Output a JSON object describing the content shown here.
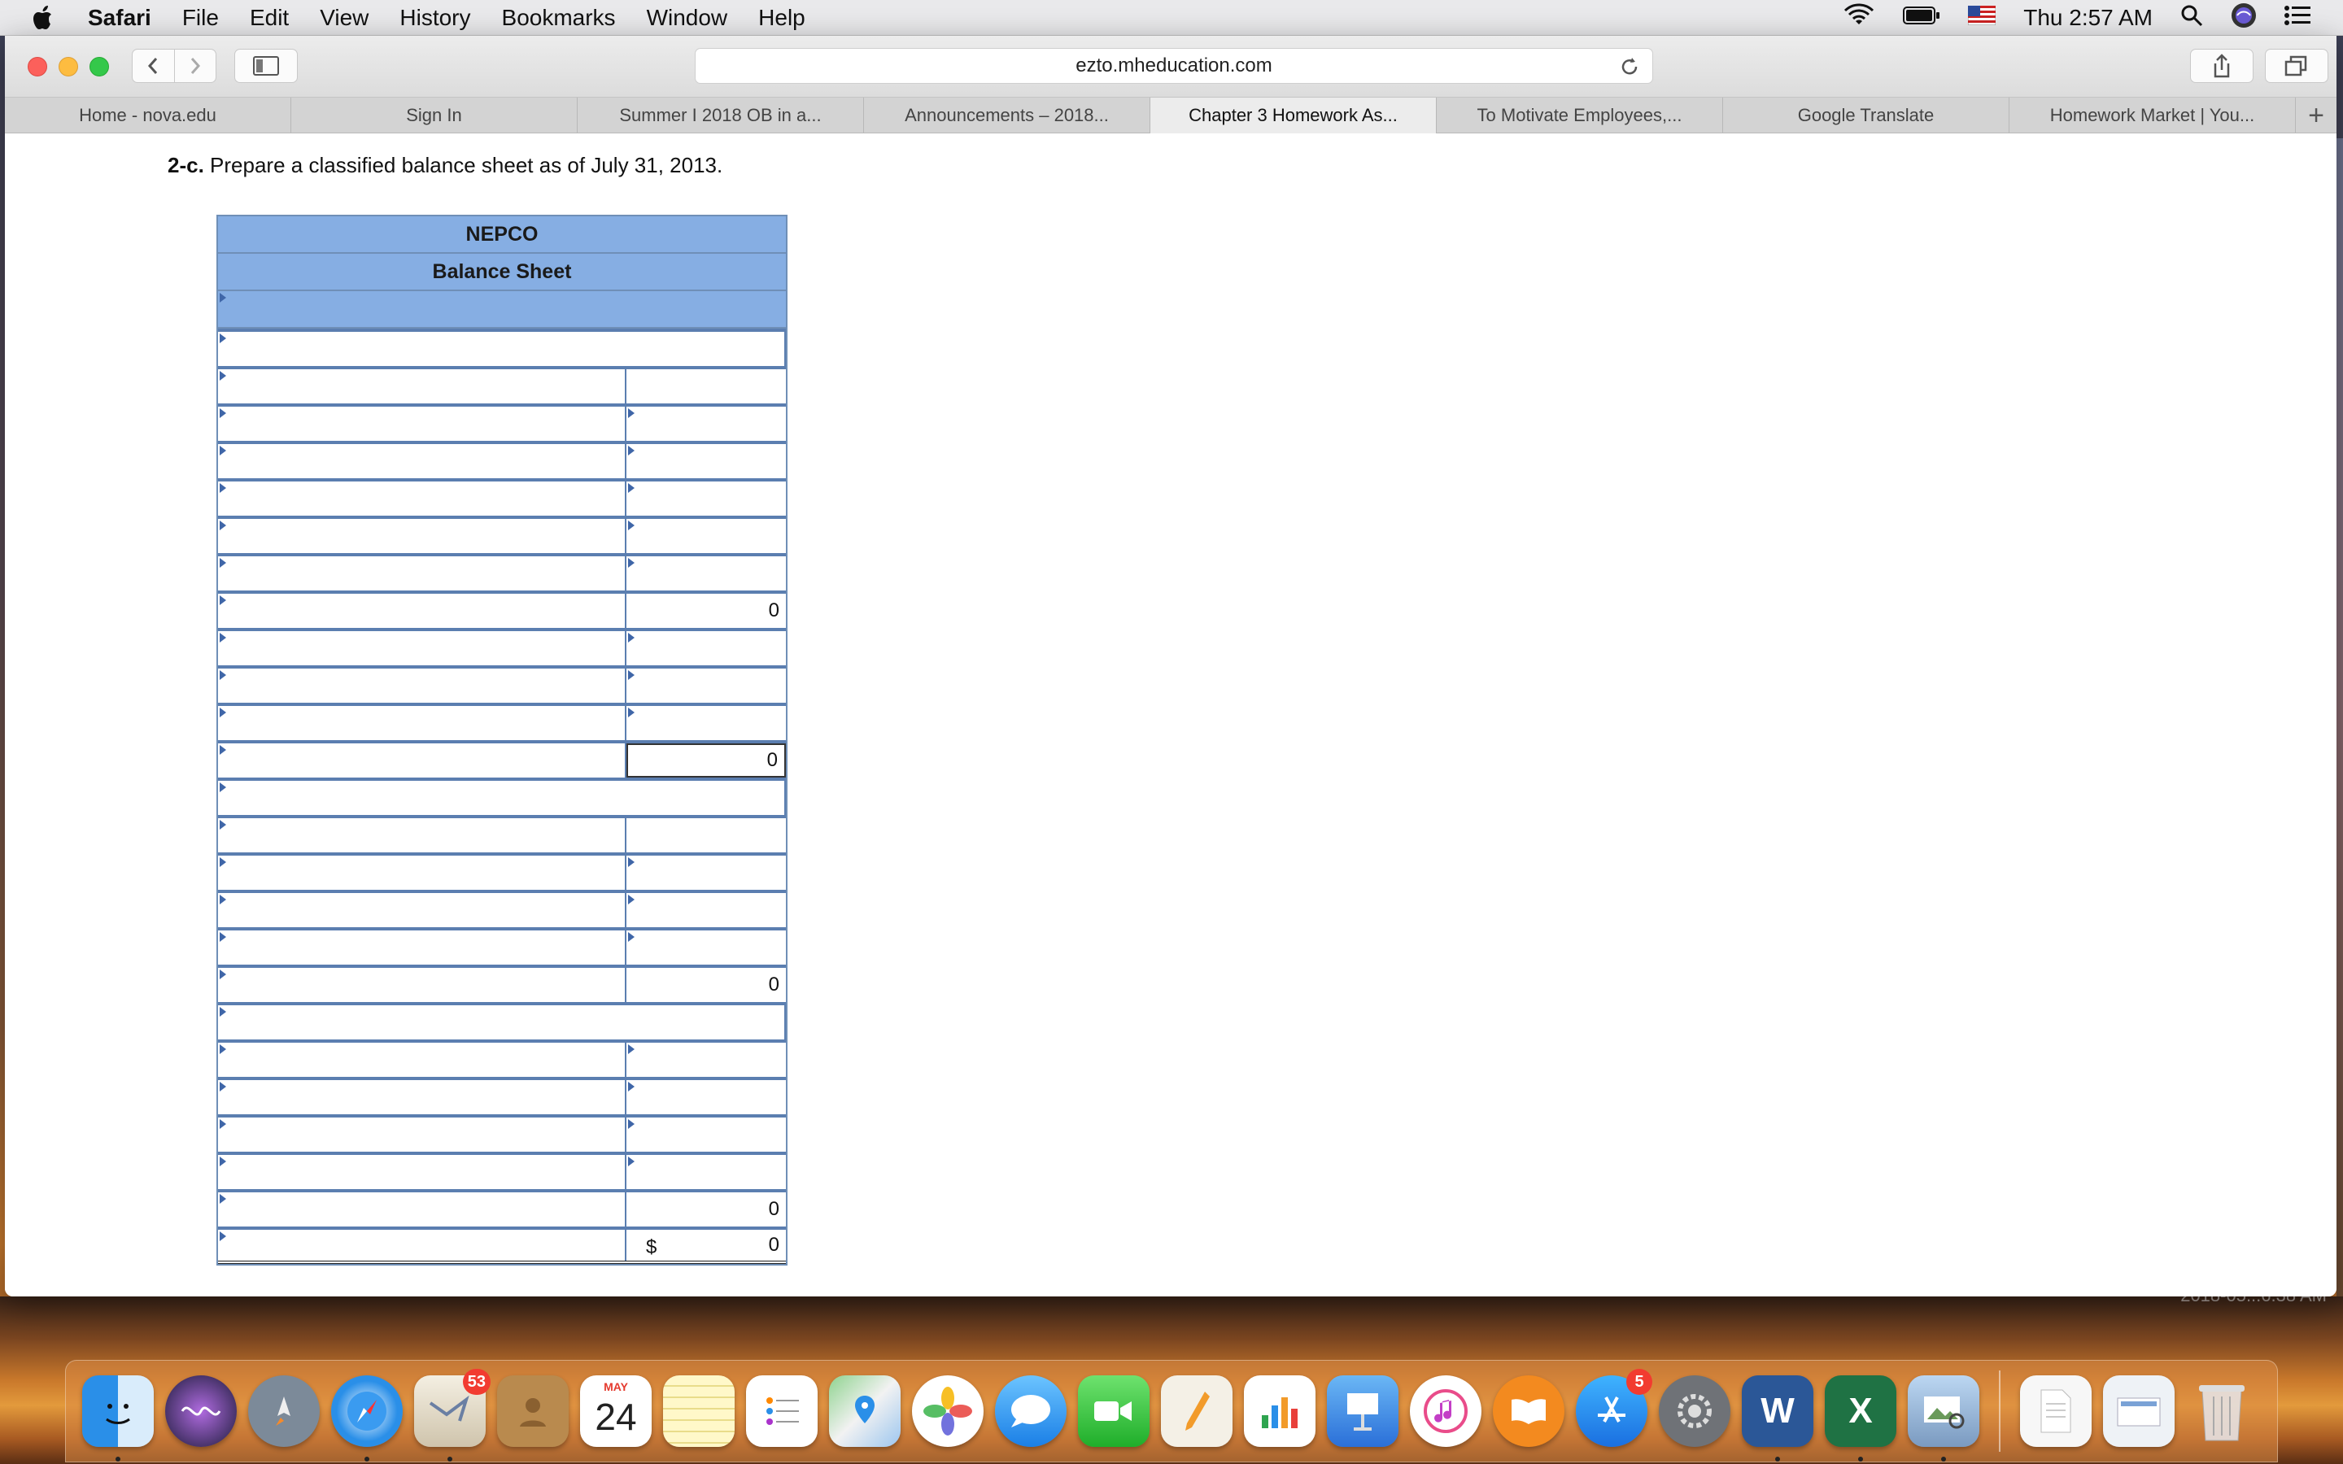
{
  "menubar": {
    "app": "Safari",
    "items": [
      "File",
      "Edit",
      "View",
      "History",
      "Bookmarks",
      "Window",
      "Help"
    ],
    "clock": "Thu 2:57 AM"
  },
  "toolbar": {
    "address": "ezto.mheducation.com"
  },
  "tabs": [
    {
      "label": "Home - nova.edu"
    },
    {
      "label": "Sign In"
    },
    {
      "label": "Summer I 2018 OB in a..."
    },
    {
      "label": "Announcements – 2018..."
    },
    {
      "label": "Chapter 3 Homework As..."
    },
    {
      "label": "To Motivate Employees,..."
    },
    {
      "label": "Google Translate"
    },
    {
      "label": "Homework Market | You..."
    }
  ],
  "question": {
    "label": "2-c.",
    "text": "Prepare a classified balance sheet as of July 31, 2013."
  },
  "sheet": {
    "company": "NEPCO",
    "title": "Balance Sheet",
    "rows": [
      {
        "amount": ""
      },
      {
        "amount": "0"
      },
      {
        "amount": "0"
      },
      {
        "amount": "0"
      },
      {
        "amount": "0"
      },
      {
        "dollar": "$",
        "amount": "0"
      }
    ]
  },
  "desktop": {
    "stamp": "2018-05...6.38 AM"
  },
  "dock": {
    "mail_badge": "53",
    "calendar_month": "MAY",
    "calendar_day": "24",
    "appstore_badge": "5"
  }
}
